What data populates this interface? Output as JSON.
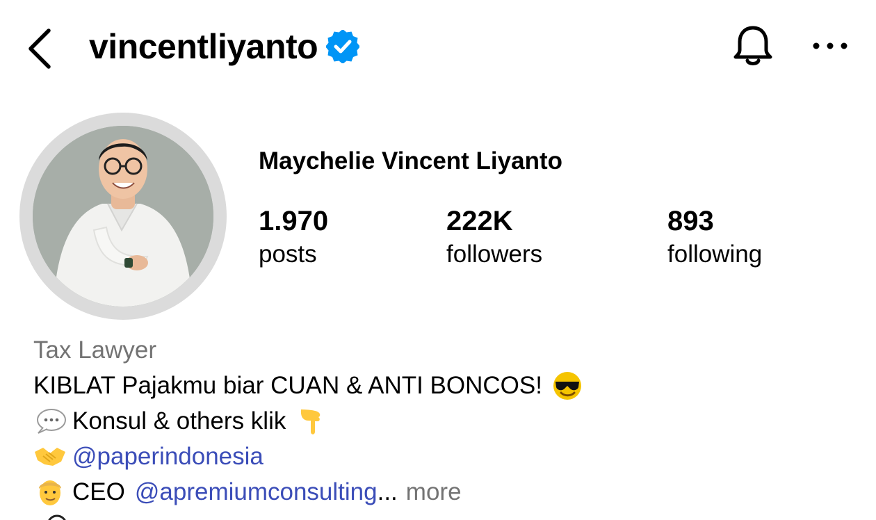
{
  "header": {
    "username": "vincentliyanto",
    "verified": true,
    "back_icon": "chevron-left-icon",
    "notification_icon": "bell-icon",
    "menu_icon": "more-horizontal-icon"
  },
  "profile": {
    "display_name": "Maychelie Vincent Liyanto",
    "stats": [
      {
        "count": "1.970",
        "label": "posts"
      },
      {
        "count": "222K",
        "label": "followers"
      },
      {
        "count": "893",
        "label": "following"
      }
    ]
  },
  "bio": {
    "category": "Tax Lawyer",
    "line1": "KIBLAT Pajakmu biar CUAN & ANTI BONCOS!",
    "line2": "Konsul & others klik",
    "line3_mention": "@paperindonesia",
    "line4_text": "CEO",
    "line4_mention": "@apremiumconsulting",
    "line4_ellipsis": "...",
    "more_label": "more"
  },
  "colors": {
    "accent_link": "#3b4db8",
    "verified_badge": "#0095f6",
    "secondary_text": "#737373",
    "avatar_ring": "#dbdbdb"
  }
}
